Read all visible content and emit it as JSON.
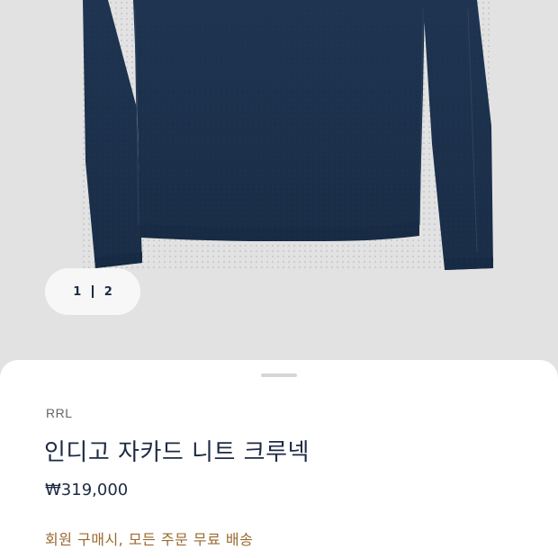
{
  "product_image": {
    "icon": "navy-crewneck-knit-sweater",
    "colors": {
      "background": "#e2e2e2",
      "sweater": "#1f3552",
      "sweater_shadow": "#172a43"
    }
  },
  "pager": {
    "current": "1",
    "total": "2"
  },
  "product": {
    "brand": "RRL",
    "title": "인디고 자카드 니트 크루넥",
    "price": "₩319,000",
    "promo": "회원 구매시, 모든 주문 무료 배송"
  },
  "colors": {
    "title": "#1d2a44",
    "promo": "#9a6a2f",
    "sheet": "#ffffff"
  }
}
